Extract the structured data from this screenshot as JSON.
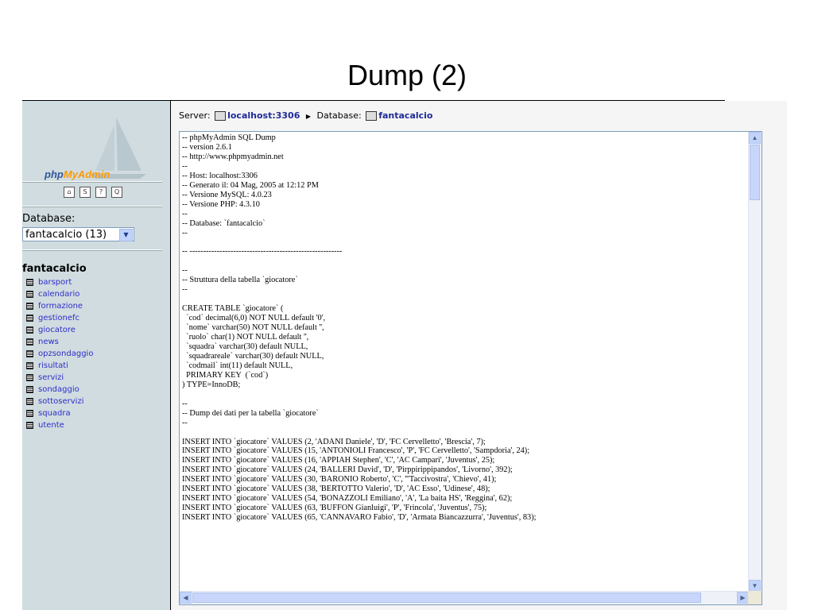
{
  "slide": {
    "title": "Dump (2)"
  },
  "nav": {
    "logo_prefix": "php",
    "logo_mid": "MyAdmin",
    "database_label": "Database:",
    "database_select": "fantacalcio (13)",
    "database_name": "fantacalcio",
    "tables": [
      "barsport",
      "calendario",
      "formazione",
      "gestionefc",
      "giocatore",
      "news",
      "opzsondaggio",
      "risultati",
      "servizi",
      "sondaggio",
      "sottoservizi",
      "squadra",
      "utente"
    ]
  },
  "header": {
    "server_label": "Server:",
    "server_value": "localhost:3306",
    "database_label": "Database:",
    "database_value": "fantacalcio"
  },
  "dump": {
    "lines": [
      "-- phpMyAdmin SQL Dump",
      "-- version 2.6.1",
      "-- http://www.phpmyadmin.net",
      "--",
      "-- Host: localhost:3306",
      "-- Generato il: 04 Mag, 2005 at 12:12 PM",
      "-- Versione MySQL: 4.0.23",
      "-- Versione PHP: 4.3.10",
      "--",
      "-- Database: `fantacalcio`",
      "--",
      "",
      "-- --------------------------------------------------------",
      "",
      "--",
      "-- Struttura della tabella `giocatore`",
      "--",
      "",
      "CREATE TABLE `giocatore` (",
      "  `cod` decimal(6,0) NOT NULL default '0',",
      "  `nome` varchar(50) NOT NULL default '',",
      "  `ruolo` char(1) NOT NULL default '',",
      "  `squadra` varchar(30) default NULL,",
      "  `squadrareale` varchar(30) default NULL,",
      "  `codmail` int(11) default NULL,",
      "  PRIMARY KEY  (`cod`)",
      ") TYPE=InnoDB;",
      "",
      "--",
      "-- Dump dei dati per la tabella `giocatore`",
      "--",
      "",
      "INSERT INTO `giocatore` VALUES (2, 'ADANI Daniele', 'D', 'FC Cervelletto', 'Brescia', 7);",
      "INSERT INTO `giocatore` VALUES (15, 'ANTONIOLI Francesco', 'P', 'FC Cervelletto', 'Sampdoria', 24);",
      "INSERT INTO `giocatore` VALUES (16, 'APPIAH Stephen', 'C', 'AC Campari', 'Juventus', 25);",
      "INSERT INTO `giocatore` VALUES (24, 'BALLERI David', 'D', 'Pirppirippipandos', 'Livorno', 392);",
      "INSERT INTO `giocatore` VALUES (30, 'BARONIO Roberto', 'C', '''Taccivostra', 'Chievo', 41);",
      "INSERT INTO `giocatore` VALUES (38, 'BERTOTTO Valerio', 'D', 'AC Esso', 'Udinese', 48);",
      "INSERT INTO `giocatore` VALUES (54, 'BONAZZOLI Emiliano', 'A', 'La baita HS', 'Reggina', 62);",
      "INSERT INTO `giocatore` VALUES (63, 'BUFFON Gianluigi', 'P', 'Frincola', 'Juventus', 75);",
      "INSERT INTO `giocatore` VALUES (65, 'CANNAVARO Fabio', 'D', 'Armata Biancazzurra', 'Juventus', 83);"
    ]
  }
}
